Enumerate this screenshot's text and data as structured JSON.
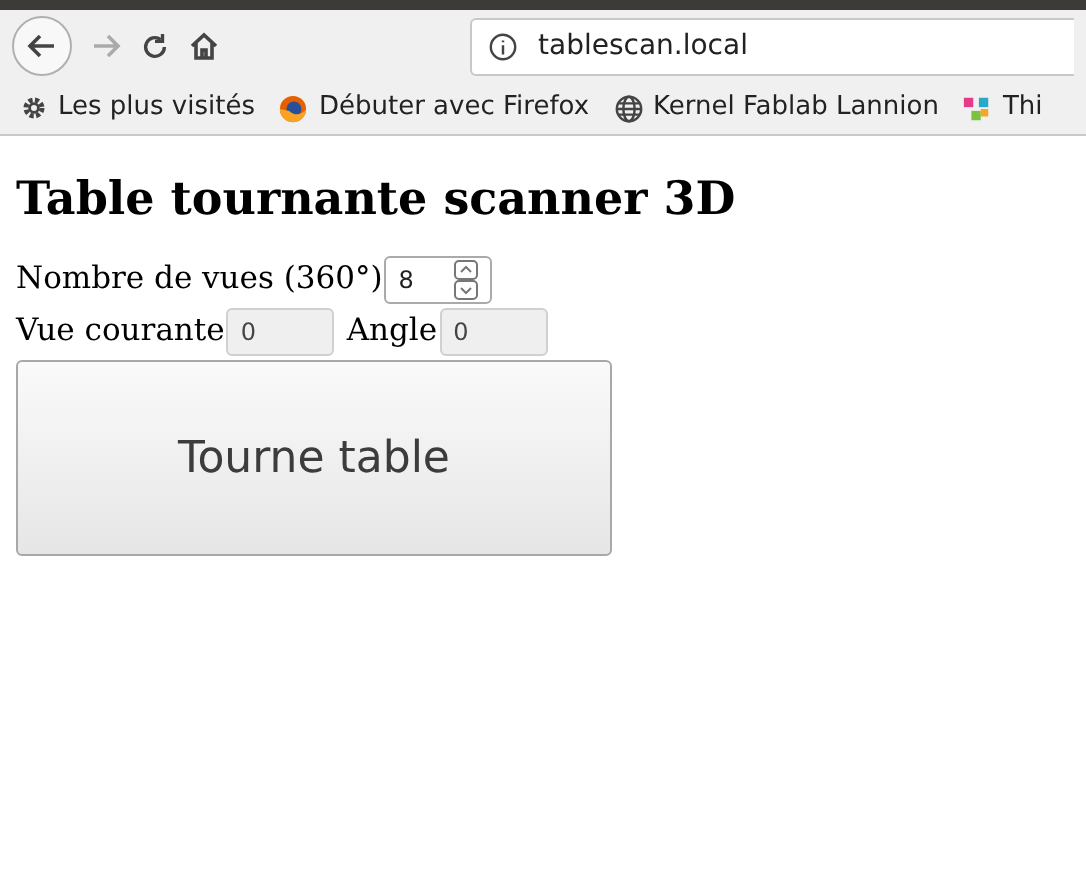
{
  "browser": {
    "url": "tablescan.local",
    "bookmarks": [
      {
        "label": "Les plus visités",
        "kind": "gear"
      },
      {
        "label": "Débuter avec Firefox",
        "kind": "firefox"
      },
      {
        "label": "Kernel Fablab Lannion",
        "kind": "globe"
      },
      {
        "label": "Thi",
        "kind": "app"
      }
    ]
  },
  "page": {
    "title": "Table tournante scanner 3D",
    "rows": [
      {
        "fields": [
          {
            "label": "Nombre de vues (360°)",
            "value": "8",
            "kind": "number",
            "disabled": false
          }
        ]
      },
      {
        "fields": [
          {
            "label": "Vue courante",
            "value": "0",
            "kind": "text",
            "disabled": true
          },
          {
            "label": "Angle",
            "value": "0",
            "kind": "text",
            "disabled": true
          }
        ]
      }
    ],
    "button": "Tourne table"
  }
}
